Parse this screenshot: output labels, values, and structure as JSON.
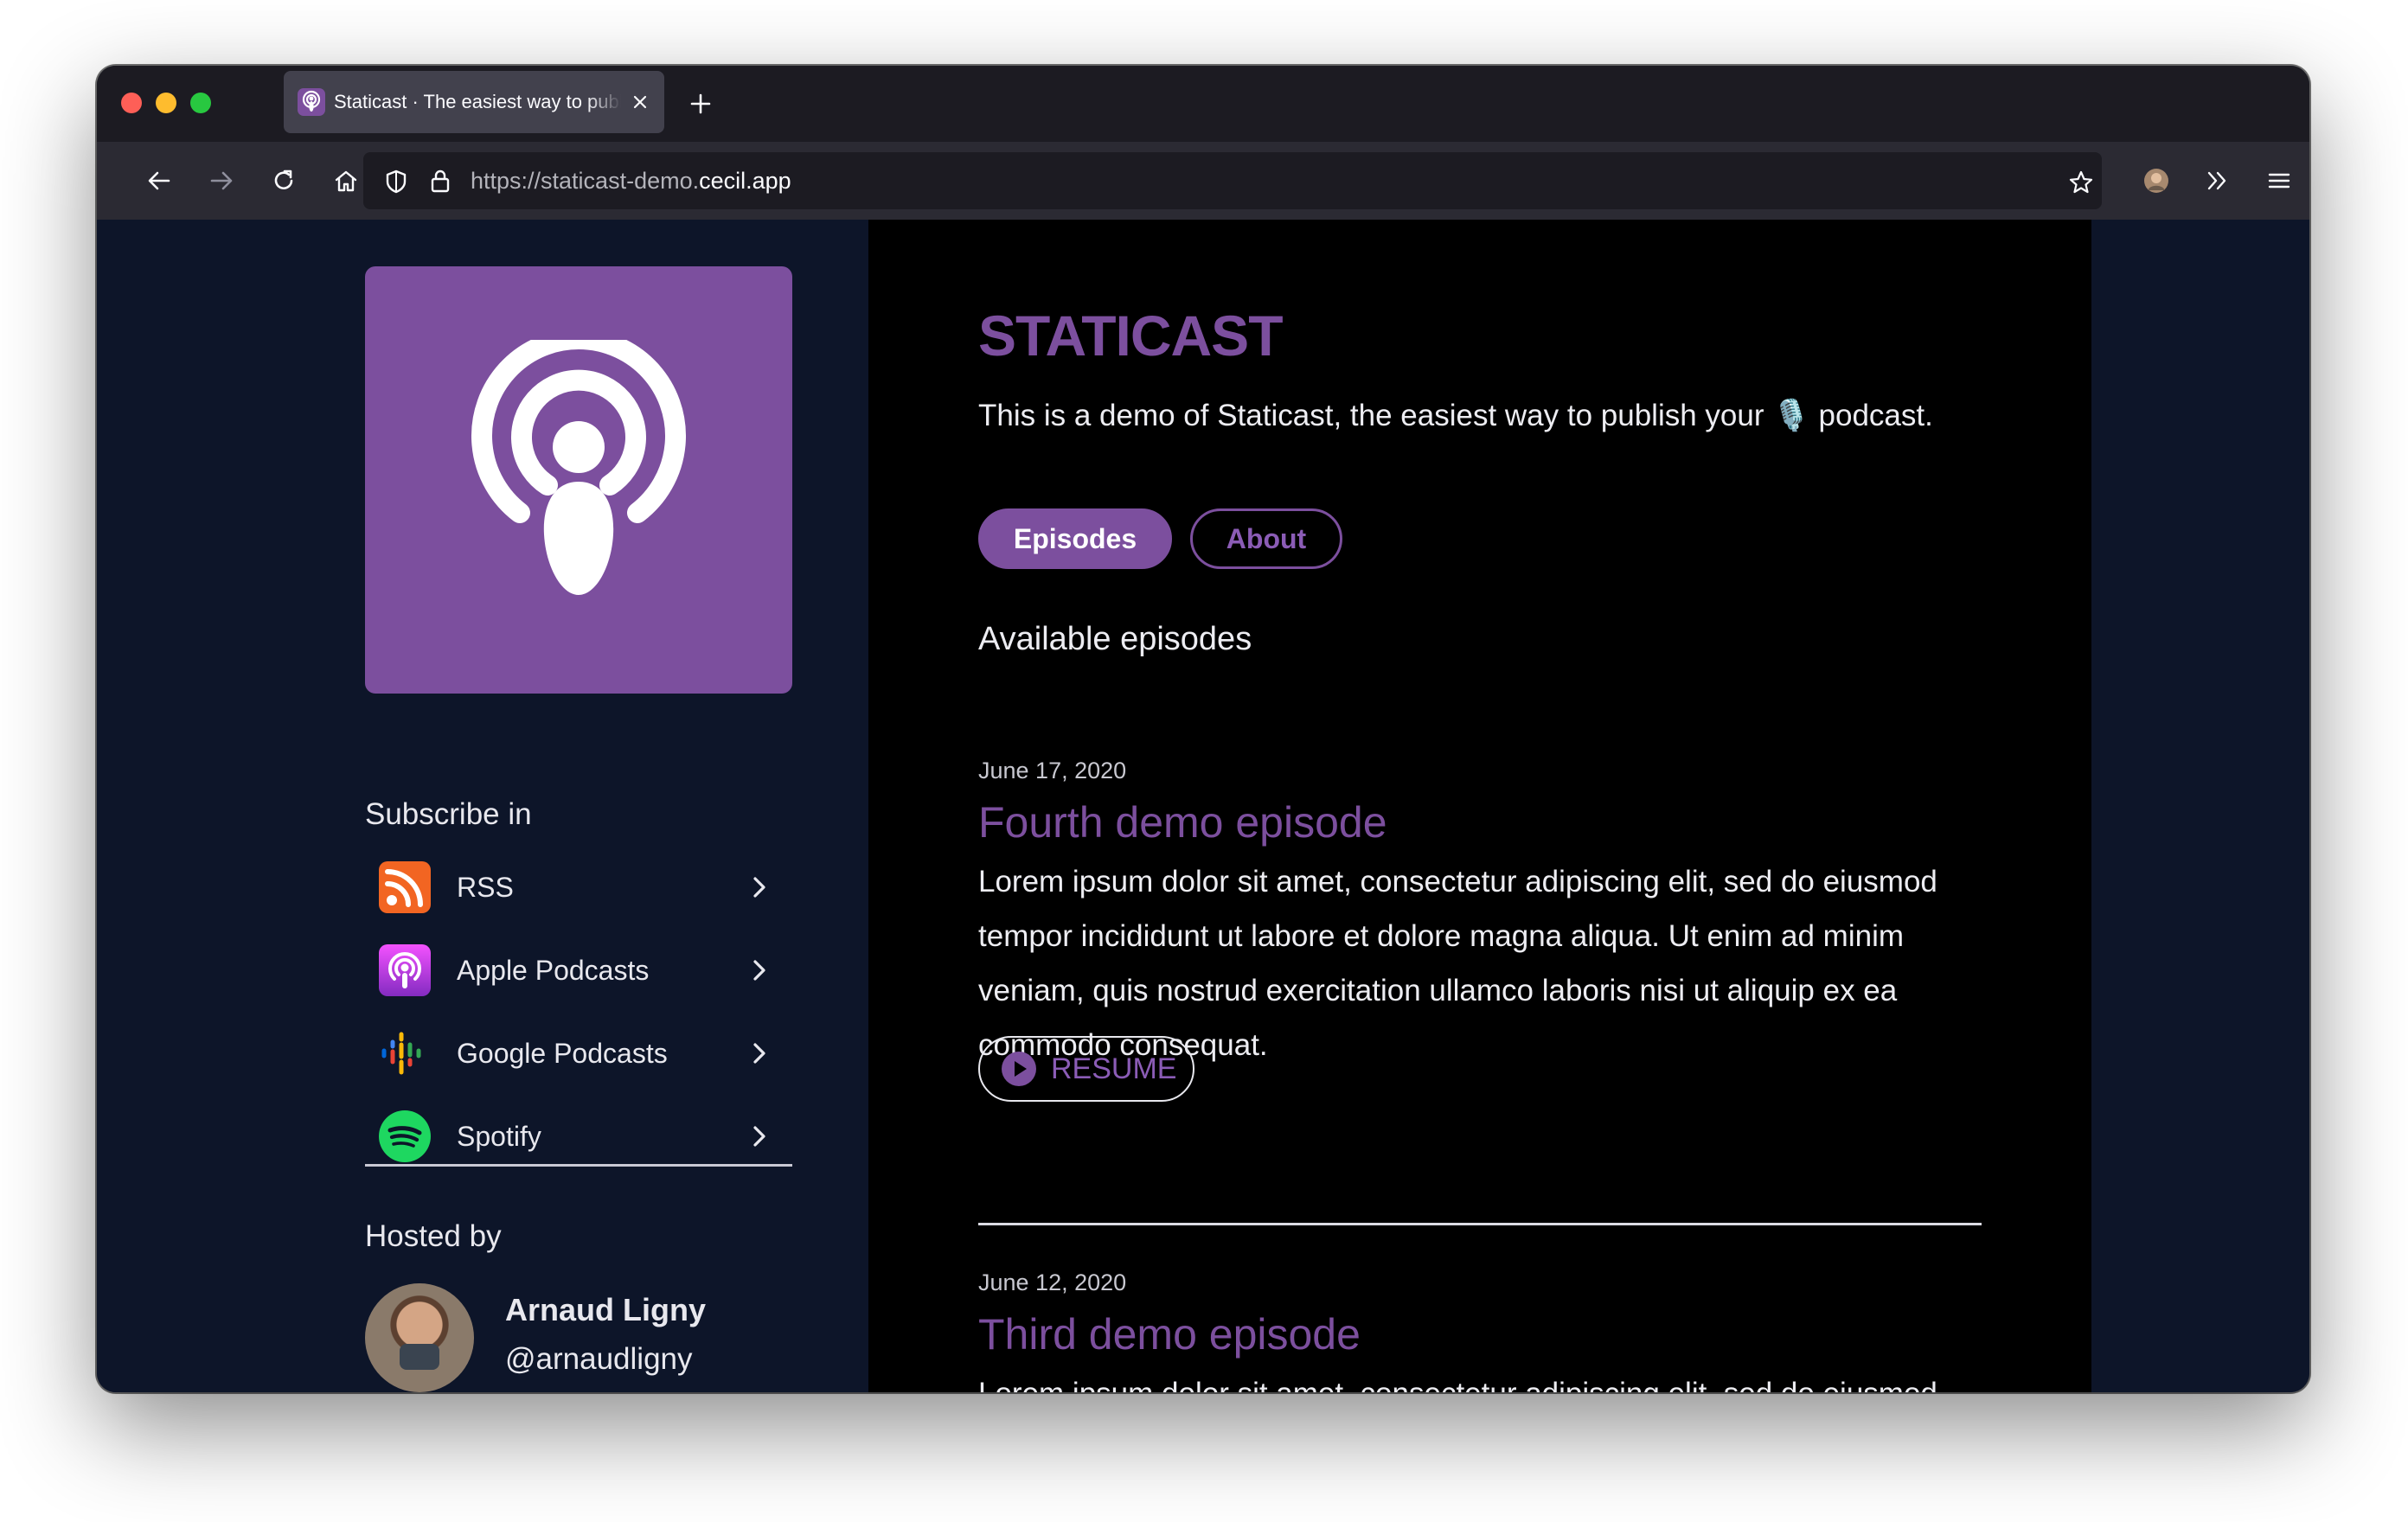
{
  "browser": {
    "tab": {
      "title": "Staticast · The easiest way to publish your podcast"
    },
    "url": {
      "base": "https://staticast-demo.",
      "domain": "cecil.app"
    }
  },
  "sidebar": {
    "subscribe_heading": "Subscribe in",
    "subscribe_items": [
      {
        "label": "RSS",
        "icon": "rss-icon"
      },
      {
        "label": "Apple Podcasts",
        "icon": "apple-podcasts-icon"
      },
      {
        "label": "Google Podcasts",
        "icon": "google-podcasts-icon"
      },
      {
        "label": "Spotify",
        "icon": "spotify-icon"
      }
    ],
    "hosted_heading": "Hosted by",
    "host": {
      "name": "Arnaud Ligny",
      "handle": "@arnaudligny"
    }
  },
  "main": {
    "title": "STATICAST",
    "description": "This is a demo of Staticast, the easiest way to publish your 🎙️ podcast.",
    "nav": {
      "episodes": "Episodes",
      "about": "About"
    },
    "episodes_heading": "Available episodes",
    "episodes": [
      {
        "date": "June 17, 2020",
        "title": "Fourth demo episode",
        "description": "Lorem ipsum dolor sit amet, consectetur adipiscing elit, sed do eiusmod tempor incididunt ut labore et dolore magna aliqua. Ut enim ad minim veniam, quis nostrud exercitation ullamco laboris nisi ut aliquip ex ea commodo consequat.",
        "action": "RESUME"
      },
      {
        "date": "June 12, 2020",
        "title": "Third demo episode",
        "description": "Lorem ipsum dolor sit amet, consectetur adipiscing elit, sed do eiusmod tempor incididunt ut labore et dolore magna aliqua. Ut enim ad minim veniam, quis nostrud exercitation ullamco laboris nisi ut aliquip ex ea commodo consequat."
      }
    ]
  },
  "colors": {
    "accent": "#7c4f9e",
    "sidebar_bg": "#0d1529",
    "main_bg": "#000000",
    "text": "#ededf2"
  }
}
